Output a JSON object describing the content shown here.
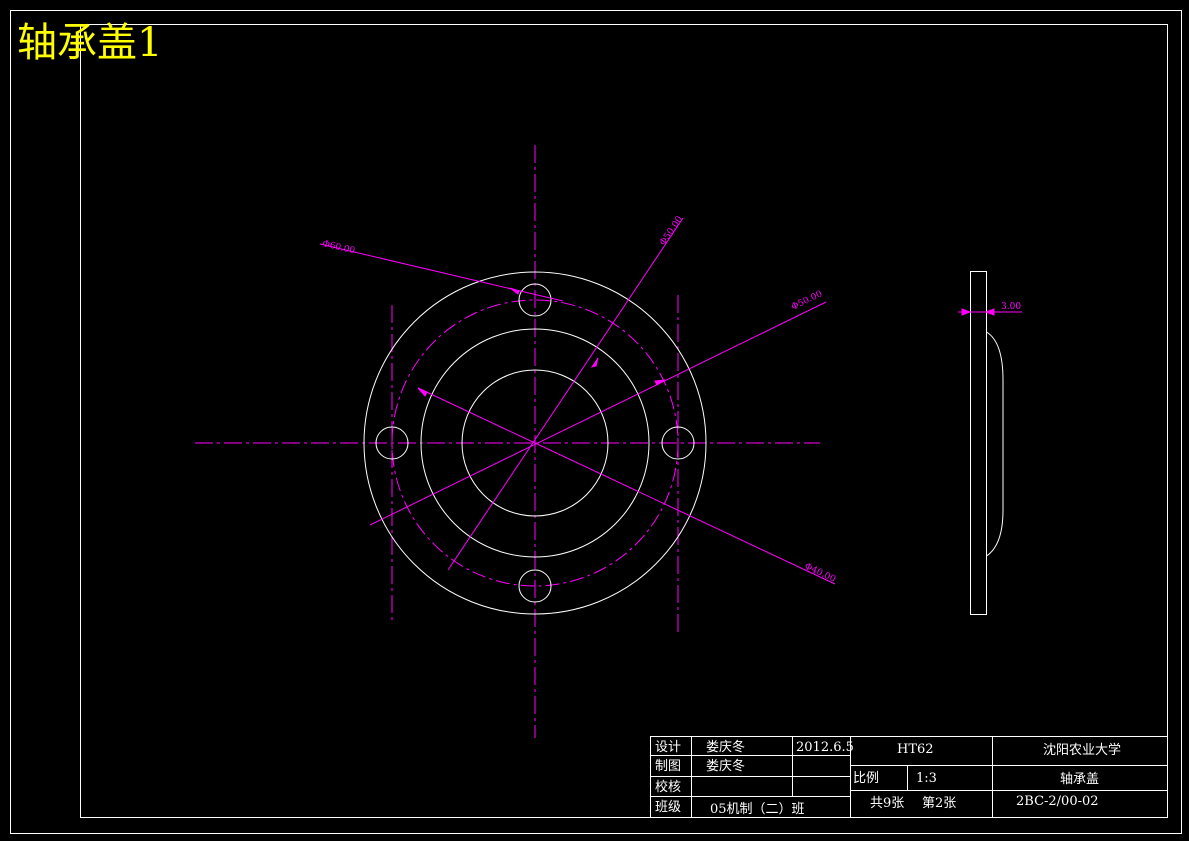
{
  "drawing": {
    "title": "轴承盖1",
    "colors": {
      "background": "#000000",
      "outline": "#ffffff",
      "centerline": "#ff00ff",
      "dimension": "#ff00ff",
      "title": "#ffff00"
    },
    "dimensions": {
      "d_outer": "Φ60.00",
      "d_bolt_circle": "Φ50.00",
      "d_mid": "Φ50.00",
      "d_inner": "Φ40.00",
      "thickness": "3.00"
    }
  },
  "title_block": {
    "design_label": "设计",
    "design_name": "娄庆冬",
    "date": "2012.6.5",
    "material": "HT62",
    "school": "沈阳农业大学",
    "drawing_label": "制图",
    "drawing_name": "娄庆冬",
    "scale_label": "比例",
    "scale_value": "1:3",
    "part_name": "轴承盖",
    "check_label": "校核",
    "class_label": "班级",
    "class_name": "05机制（二）班",
    "total_sheets": "共9张",
    "sheet_no": "第2张",
    "drawing_code": "2BC-2/00-02"
  }
}
